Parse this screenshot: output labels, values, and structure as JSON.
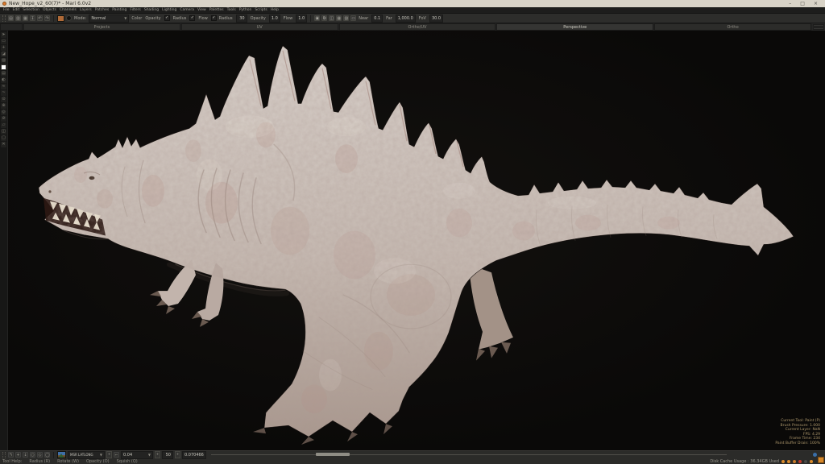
{
  "window": {
    "title": "New_Hope_v2_60(7)* - Mari 6.0v2",
    "controls": [
      {
        "name": "minimize-button",
        "glyph": "–"
      },
      {
        "name": "maximize-button",
        "glyph": "□"
      },
      {
        "name": "close-button",
        "glyph": "×"
      }
    ]
  },
  "menu_bar": {
    "items": [
      "File",
      "Edit",
      "Selection",
      "Objects",
      "Channels",
      "Layers",
      "Patches",
      "Painting",
      "Filters",
      "Shading",
      "Lighting",
      "Camera",
      "View",
      "Palettes",
      "Tools",
      "Python",
      "Scripts",
      "Help"
    ]
  },
  "toolbar": {
    "file_icons": [
      {
        "name": "new-project-icon",
        "glyph": "▤"
      },
      {
        "name": "open-project-icon",
        "glyph": "▥"
      },
      {
        "name": "save-icon",
        "glyph": "▦"
      },
      {
        "name": "import-icon",
        "glyph": "↧"
      },
      {
        "name": "undo-icon",
        "glyph": "↶"
      },
      {
        "name": "redo-icon",
        "glyph": "↷"
      }
    ],
    "paint_color_swatch": "#b06a38",
    "mode_label": "Mode:",
    "mode_value": "Normal",
    "color_label": "Color",
    "pressure_toggles": [
      {
        "label": "Opacity",
        "checked": true
      },
      {
        "label": "Radius",
        "checked": true
      },
      {
        "label": "Flow",
        "checked": true
      }
    ],
    "value_fields": [
      {
        "label": "Radius",
        "value": "30"
      },
      {
        "label": "Opacity",
        "value": "1.0"
      },
      {
        "label": "Flow",
        "value": "1.0"
      }
    ],
    "paint_icons": [
      {
        "name": "paint-buffer-icon",
        "glyph": "▣"
      },
      {
        "name": "projection-icon",
        "glyph": "⧉"
      },
      {
        "name": "symmetry-icon",
        "glyph": "◫"
      },
      {
        "name": "uv-grid-icon",
        "glyph": "▦"
      },
      {
        "name": "paint-through-icon",
        "glyph": "▨"
      },
      {
        "name": "camera-lock-icon",
        "glyph": "▭"
      }
    ],
    "clip_fields": [
      {
        "label": "Near",
        "value": "0.1"
      },
      {
        "label": "Far",
        "value": "1,000.0"
      },
      {
        "label": "FoV",
        "value": "30.0"
      }
    ]
  },
  "view_tabs": {
    "tabs": [
      "Projects",
      "UV",
      "Ortho/UV",
      "Perspective",
      "Ortho"
    ],
    "active_index": 3
  },
  "left_toolbar": {
    "tools": [
      {
        "name": "select-tool",
        "glyph": "➤"
      },
      {
        "name": "marquee-select-tool",
        "glyph": "▭"
      },
      {
        "name": "transform-tool",
        "glyph": "+"
      },
      {
        "name": "paint-tool",
        "glyph": "◪"
      },
      {
        "name": "eraser-tool",
        "glyph": "▨"
      },
      {
        "name": "foreground-color-swatch",
        "swatch": "#ffffff"
      },
      {
        "name": "clone-stamp-tool",
        "glyph": "▤"
      },
      {
        "name": "gradient-tool",
        "glyph": "◐"
      },
      {
        "name": "blur-tool",
        "glyph": "≈"
      },
      {
        "name": "smear-tool",
        "glyph": "~"
      },
      {
        "name": "slerp-tool",
        "glyph": "⊙"
      },
      {
        "name": "pin-tool",
        "glyph": "⊕"
      },
      {
        "name": "warp-tool",
        "glyph": "◎"
      },
      {
        "name": "vector-paint-tool",
        "glyph": "⊘"
      },
      {
        "name": "paint-through-tool",
        "glyph": "▱"
      },
      {
        "name": "color-picker-tool",
        "glyph": "◫"
      },
      {
        "name": "node-tool",
        "glyph": "▢"
      },
      {
        "name": "pan-tool",
        "glyph": "✕"
      }
    ]
  },
  "viewport": {
    "hud_lines": [
      "Current Tool: Paint (P)",
      "Brush Pressure: 1.000",
      "Current Layer: NaN",
      "FPS: 4.29",
      "Frame Time: 234",
      "Paint Buffer Drain: 100%"
    ]
  },
  "status_bar": {
    "nav_icons": [
      {
        "name": "undo-stroke-icon",
        "glyph": "↰"
      },
      {
        "name": "move-icon",
        "glyph": "+"
      },
      {
        "name": "bake-down-icon",
        "glyph": "↓"
      },
      {
        "name": "circle-brush-icon",
        "glyph": "○"
      },
      {
        "name": "mirror-icon",
        "glyph": "◇"
      },
      {
        "name": "ellipse-icon",
        "glyph": "◯"
      }
    ],
    "env_dropdown_value": "MSR LATLONG",
    "falloff_dropdown_value": "0.04",
    "spin_value": "50",
    "rotation_value": "0.070466",
    "tool_help_label": "Tool Help:",
    "shortcuts": [
      "Radius (R)",
      "Rotate (W)",
      "Opacity (O)",
      "Squish (Q)"
    ],
    "disk_cache_text": "Disk Cache Usage : 36.34GB Used",
    "indicators": [
      "#d98a2b",
      "#d98a2b",
      "#c87a2a",
      "#c23a2a",
      "#4a4a46",
      "#d98a2b"
    ],
    "corner_color": "#d98a2b"
  }
}
